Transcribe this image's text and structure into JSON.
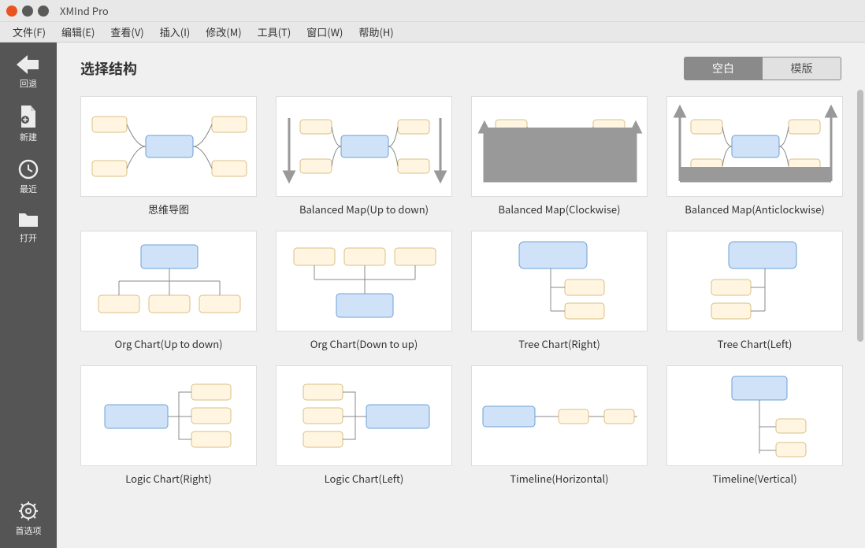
{
  "window": {
    "title": "XMInd Pro"
  },
  "menu": [
    "文件(F)",
    "编辑(E)",
    "查看(V)",
    "插入(I)",
    "修改(M)",
    "工具(T)",
    "窗口(W)",
    "帮助(H)"
  ],
  "sidebar": {
    "back": {
      "label": "回退"
    },
    "new": {
      "label": "新建"
    },
    "recent": {
      "label": "最近"
    },
    "open": {
      "label": "打开"
    },
    "prefs": {
      "label": "首选项"
    }
  },
  "page": {
    "heading": "选择结构",
    "toggle": {
      "blank": "空白",
      "template": "模版",
      "active": "blank"
    }
  },
  "templates": [
    {
      "id": "mindmap",
      "label": "思维导图"
    },
    {
      "id": "balanced-down",
      "label": "Balanced Map(Up to down)"
    },
    {
      "id": "balanced-clockwise",
      "label": "Balanced Map(Clockwise)"
    },
    {
      "id": "balanced-anticw",
      "label": "Balanced Map(Anticlockwise)"
    },
    {
      "id": "org-down",
      "label": "Org Chart(Up to down)"
    },
    {
      "id": "org-up",
      "label": "Org Chart(Down to up)"
    },
    {
      "id": "tree-right",
      "label": "Tree Chart(Right)"
    },
    {
      "id": "tree-left",
      "label": "Tree Chart(Left)"
    },
    {
      "id": "logic-right",
      "label": "Logic Chart(Right)"
    },
    {
      "id": "logic-left",
      "label": "Logic Chart(Left)"
    },
    {
      "id": "timeline-h",
      "label": "Timeline(Horizontal)"
    },
    {
      "id": "timeline-v",
      "label": "Timeline(Vertical)"
    }
  ]
}
